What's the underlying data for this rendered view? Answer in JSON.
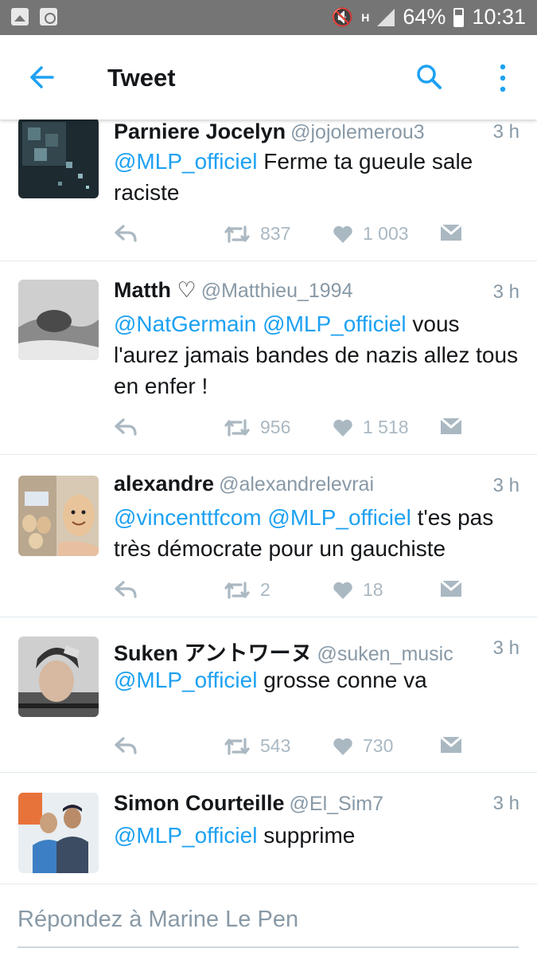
{
  "statusbar": {
    "battery": "64%",
    "time": "10:31",
    "network": "H"
  },
  "appbar": {
    "title": "Tweet"
  },
  "tweets": [
    {
      "name": "Parniere Jocelyn",
      "handle": "@jojolemerou3",
      "time": "3 h",
      "text_parts": [
        "@MLP_officiel",
        " Ferme ta gueule sale raciste"
      ],
      "retweets": "837",
      "likes": "1 003"
    },
    {
      "name": "Matth ♡",
      "handle": "@Matthieu_1994",
      "time": "3 h",
      "text_parts": [
        "@NatGermain",
        " ",
        "@MLP_officiel",
        " vous l'aurez jamais bandes de nazis allez tous en enfer !"
      ],
      "retweets": "956",
      "likes": "1 518"
    },
    {
      "name": "alexandre",
      "handle": "@alexandrelevrai",
      "time": "3 h",
      "text_parts": [
        "@vincenttfcom",
        " ",
        "@MLP_officiel",
        " t'es pas très démocrate pour un gauchiste"
      ],
      "retweets": "2",
      "likes": "18"
    },
    {
      "name": "Suken アントワーヌ",
      "handle": "@suken_music",
      "time": "3 h",
      "text_parts": [
        "@MLP_officiel",
        " grosse conne va"
      ],
      "retweets": "543",
      "likes": "730"
    },
    {
      "name": "Simon Courteille",
      "handle": "@El_Sim7",
      "time": "3 h",
      "text_parts": [
        "@MLP_officiel",
        " supprime"
      ]
    }
  ],
  "reply": {
    "placeholder": "Répondez à Marine Le Pen"
  },
  "colors": {
    "accent": "#1da1f2",
    "muted": "#aab8c2",
    "statusbar": "#757575"
  }
}
